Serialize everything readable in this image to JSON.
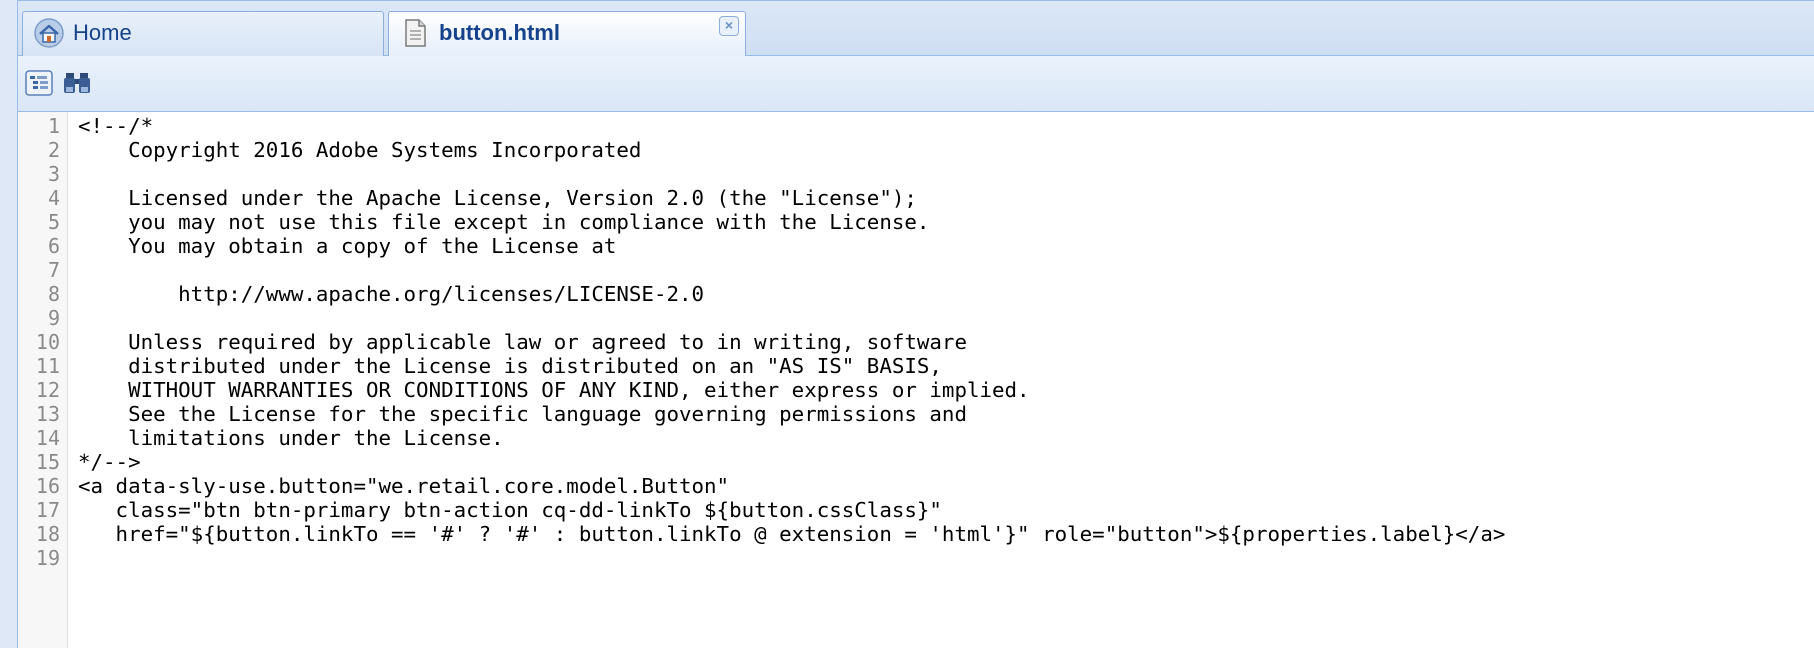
{
  "tabs": [
    {
      "label": "Home",
      "icon": "home-icon",
      "active": false
    },
    {
      "label": "button.html",
      "icon": "file-icon",
      "active": true
    }
  ],
  "toolbar": {
    "buttons": [
      {
        "icon": "outline-icon"
      },
      {
        "icon": "binoculars-icon"
      }
    ]
  },
  "colors": {
    "tab_text": "#15428b",
    "border": "#99bbe8",
    "line_numbers": "#8a8a8a"
  },
  "editor": {
    "lines": [
      {
        "num": "1",
        "text": "<!--/*"
      },
      {
        "num": "2",
        "text": "    Copyright 2016 Adobe Systems Incorporated"
      },
      {
        "num": "3",
        "text": ""
      },
      {
        "num": "4",
        "text": "    Licensed under the Apache License, Version 2.0 (the \"License\");"
      },
      {
        "num": "5",
        "text": "    you may not use this file except in compliance with the License."
      },
      {
        "num": "6",
        "text": "    You may obtain a copy of the License at"
      },
      {
        "num": "7",
        "text": ""
      },
      {
        "num": "8",
        "text": "        http://www.apache.org/licenses/LICENSE-2.0"
      },
      {
        "num": "9",
        "text": ""
      },
      {
        "num": "10",
        "text": "    Unless required by applicable law or agreed to in writing, software"
      },
      {
        "num": "11",
        "text": "    distributed under the License is distributed on an \"AS IS\" BASIS,"
      },
      {
        "num": "12",
        "text": "    WITHOUT WARRANTIES OR CONDITIONS OF ANY KIND, either express or implied."
      },
      {
        "num": "13",
        "text": "    See the License for the specific language governing permissions and"
      },
      {
        "num": "14",
        "text": "    limitations under the License."
      },
      {
        "num": "15",
        "text": "*/-->"
      },
      {
        "num": "16",
        "text": "<a data-sly-use.button=\"we.retail.core.model.Button\""
      },
      {
        "num": "17",
        "text": "   class=\"btn btn-primary btn-action cq-dd-linkTo ${button.cssClass}\""
      },
      {
        "num": "18",
        "text": "   href=\"${button.linkTo == '#' ? '#' : button.linkTo @ extension = 'html'}\" role=\"button\">${properties.label}</a>"
      },
      {
        "num": "19",
        "text": ""
      }
    ]
  }
}
